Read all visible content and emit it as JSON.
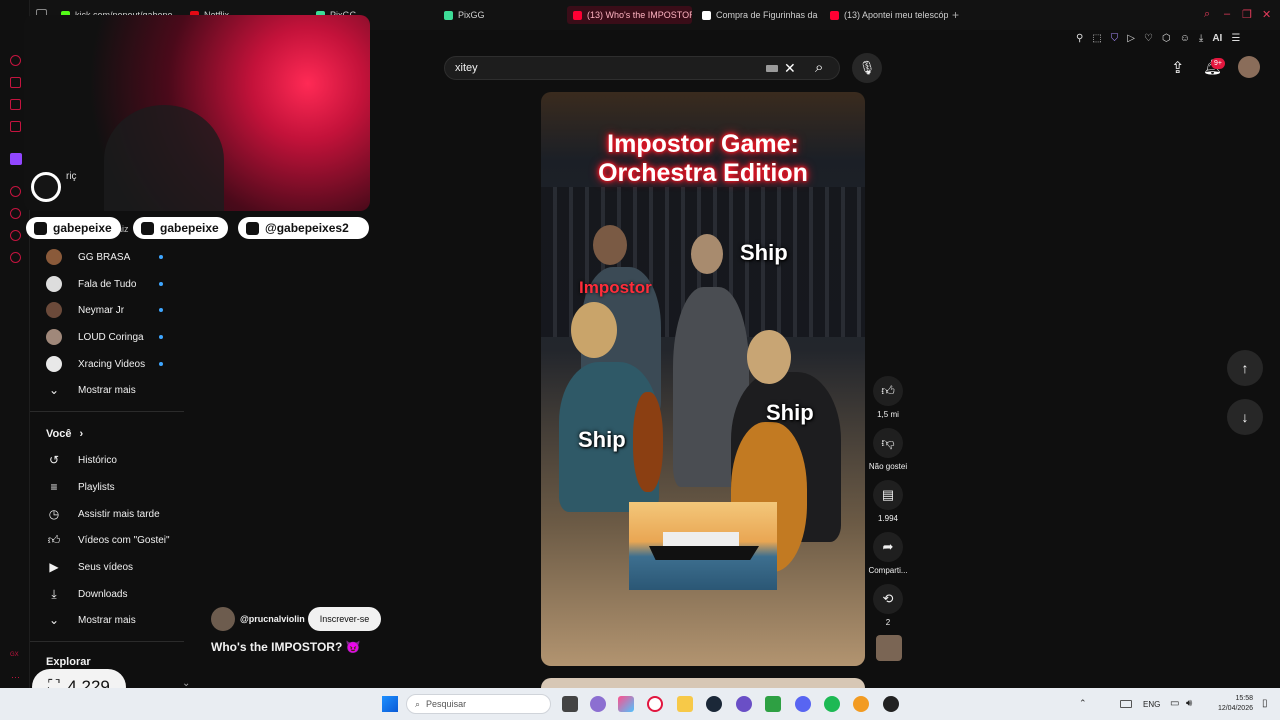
{
  "tabs": [
    {
      "label": "kick.com/popout/gabepe",
      "color": "#53fc18"
    },
    {
      "label": "Netflix",
      "color": "#e50914"
    },
    {
      "label": "PixGG",
      "color": "#3ddc97"
    },
    {
      "label": "PixGG",
      "color": "#3ddc97"
    },
    {
      "label": "(13) Who's the IMPOSTOR",
      "color": "#ff0033"
    },
    {
      "label": "Compra de Figurinhas da",
      "color": "#ffffff"
    },
    {
      "label": "(13) Apontei meu telescópi",
      "color": "#ff0033"
    }
  ],
  "tab_new": "+",
  "toolbar_ai": "AI",
  "search": {
    "query": "xitey"
  },
  "notification_badge": "9+",
  "socials": [
    {
      "handle": "gabepeixe",
      "icon": "youtube-icon"
    },
    {
      "handle": "gabepeixe",
      "icon": "instagram-icon"
    },
    {
      "handle": "@gabepeixes2",
      "icon": "tiktok-icon"
    }
  ],
  "cam_partial_texts": [
    "riç",
    "aiz"
  ],
  "subscriptions": [
    {
      "name": "GG BRASA",
      "color": "#8a5a3a"
    },
    {
      "name": "Fala de Tudo",
      "color": "#dddddd"
    },
    {
      "name": "Neymar Jr",
      "color": "#6b4a3a"
    },
    {
      "name": "LOUD Coringa",
      "color": "#a0887a"
    },
    {
      "name": "Xracing Videos",
      "color": "#e8e8e8"
    }
  ],
  "show_more": "Mostrar mais",
  "you_section": {
    "title": "Você",
    "items": [
      {
        "label": "Histórico",
        "icon": "history-icon"
      },
      {
        "label": "Playlists",
        "icon": "playlist-icon"
      },
      {
        "label": "Assistir mais tarde",
        "icon": "clock-icon"
      },
      {
        "label": "Vídeos com \"Gostei\"",
        "icon": "thumbs-up-icon"
      },
      {
        "label": "Seus vídeos",
        "icon": "video-icon"
      },
      {
        "label": "Downloads",
        "icon": "download-icon"
      }
    ],
    "show_more": "Mostrar mais"
  },
  "explore_title": "Explorar",
  "points_badge": "4.229",
  "short": {
    "overlay_title_line1": "Impostor Game:",
    "overlay_title_line2": "Orchestra Edition",
    "label_impostor": "Impostor",
    "label_ship": "Ship",
    "channel": "@prucnalviolin",
    "subscribe": "Inscrever-se",
    "title": "Who's the IMPOSTOR? 😈"
  },
  "actions": {
    "likes": "1,5 mi",
    "dislike": "Não gostei",
    "comments": "1.994",
    "share": "Comparti...",
    "remix": "2"
  },
  "taskbar": {
    "search_placeholder": "Pesquisar",
    "lang": "ENG",
    "time": "15:58",
    "date": "12/04/2026"
  },
  "opera_sidebar_label": "GX"
}
